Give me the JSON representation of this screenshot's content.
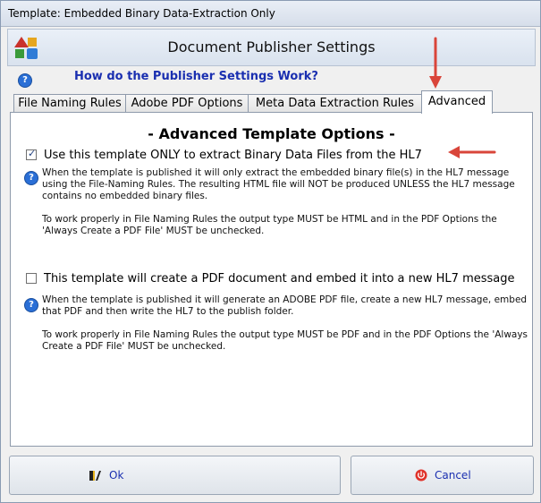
{
  "window": {
    "title": "Template: Embedded Binary Data-Extraction Only"
  },
  "header": {
    "title": "Document Publisher Settings",
    "logo_icon": "app-logo-icon"
  },
  "help": {
    "icon": "help-icon",
    "link": "How do the Publisher Settings Work?"
  },
  "tabs": [
    {
      "label": "File Naming Rules",
      "active": false
    },
    {
      "label": "Adobe PDF Options",
      "active": false
    },
    {
      "label": "Meta Data Extraction Rules",
      "active": false
    },
    {
      "label": "Advanced",
      "active": true
    }
  ],
  "advanced": {
    "title": "- Advanced Template Options -",
    "option1": {
      "label": "Use this template ONLY to extract Binary Data Files from the HL7",
      "checked": true,
      "note1": "When the template is published it will only extract the embedded binary file(s) in the HL7 message using the File-Naming Rules. The resulting HTML file will NOT be produced UNLESS the HL7 message contains no embedded binary files.",
      "note2": "To work properly in File Naming Rules the output type MUST be HTML and in the PDF Options the 'Always Create a PDF File' MUST be unchecked."
    },
    "option2": {
      "label": "This template will create a PDF document and embed it into a new HL7 message",
      "checked": false,
      "note1": "When the template is published it will generate an ADOBE PDF file, create a new HL7 message, embed that PDF and then write the HL7 to the publish folder.",
      "note2": "To work properly in File Naming Rules the output type MUST be PDF and in the PDF Options the 'Always Create a PDF File' MUST be unchecked."
    }
  },
  "footer": {
    "ok_label": "Ok",
    "cancel_label": "Cancel"
  },
  "colors": {
    "arrow": "#d9453a",
    "link": "#1a2fb0",
    "cancel_icon": "#e0322a"
  }
}
